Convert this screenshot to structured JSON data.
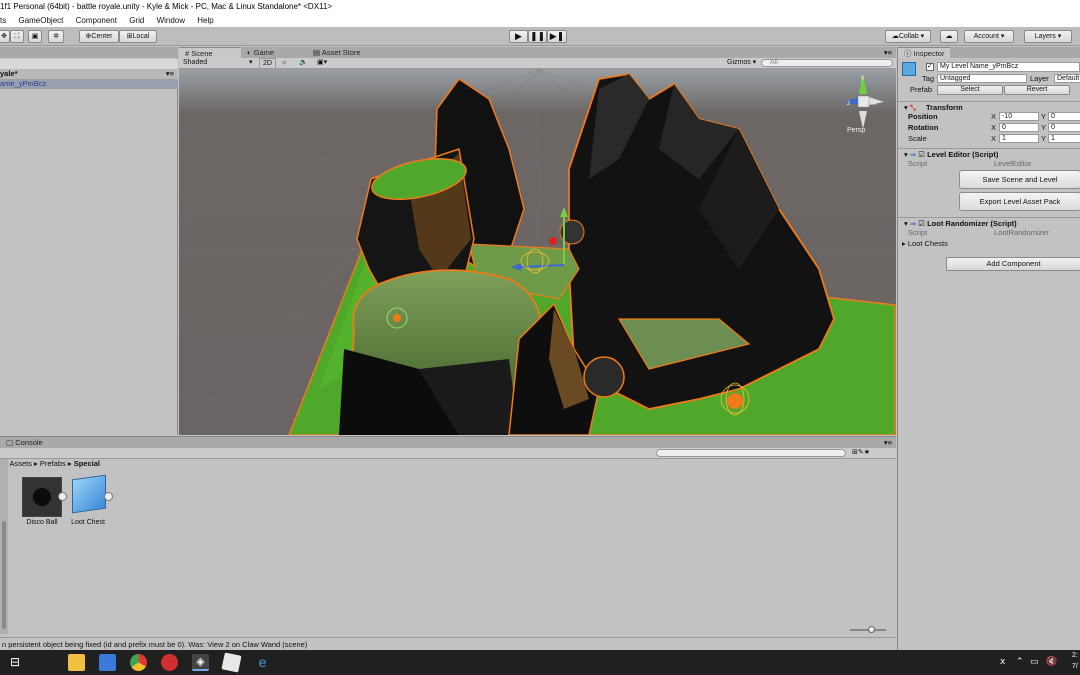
{
  "window": {
    "title": "1f1 Personal (64bit) - battle royale.unity - Kyle & Mick - PC, Mac & Linux Standalone* <DX11>"
  },
  "menu": [
    "ts",
    "GameObject",
    "Component",
    "Grid",
    "Window",
    "Help"
  ],
  "toolbar": {
    "center": "Center",
    "local": "Local",
    "collab": "Collab ▾",
    "account": "Account ▾",
    "layers": "Layers ▾"
  },
  "hierarchy": {
    "scene_name": "yale*",
    "selected_item": "ame_yPmBcz"
  },
  "scene_tabs": [
    "Scene",
    "Game",
    "Asset Store"
  ],
  "scene_toolbar": {
    "shading": "Shaded",
    "mode2d": "2D",
    "gizmos": "Gizmos ▾",
    "search_placeholder": "All"
  },
  "scene_view": {
    "persp": "Persp"
  },
  "inspector": {
    "tab": "Inspector",
    "object_name": "My Level Name_yPmBcz",
    "tag_label": "Tag",
    "tag_value": "Untagged",
    "layer_label": "Layer",
    "layer_value": "Default",
    "prefab_label": "Prefab",
    "select": "Select",
    "revert": "Revert",
    "transform": "Transform",
    "position": "Position",
    "rotation": "Rotation",
    "scale": "Scale",
    "px": "-10",
    "py": "0",
    "rx": "0",
    "ry": "0",
    "sx": "1",
    "sy": "1",
    "xlbl": "X",
    "ylbl": "Y",
    "level_editor": "Level Editor (Script)",
    "script_label": "Script",
    "level_editor_script": "LevelEditor",
    "save_scene": "Save Scene and Level",
    "export_pack": "Export Level Asset Pack",
    "loot_randomizer": "Loot Randomizer (Script)",
    "loot_script": "LootRandomizer",
    "loot_chests": "Loot Chests",
    "add_component": "Add Component"
  },
  "console": {
    "tab": "Console"
  },
  "project": {
    "breadcrumb": [
      "Assets",
      "Prefabs",
      "Special"
    ],
    "assets": [
      {
        "label": "Disco Ball"
      },
      {
        "label": "Loot Chest"
      }
    ]
  },
  "status": {
    "message": "n persistent object being fixed (id and prefix must be 0). Was: View 2 on Claw Wand (scene)"
  },
  "taskbar": {
    "time": "2:",
    "date": "7/"
  },
  "colors": {
    "grass": "#4fa82a",
    "rock": "#111111",
    "outline": "#f07a1a"
  }
}
